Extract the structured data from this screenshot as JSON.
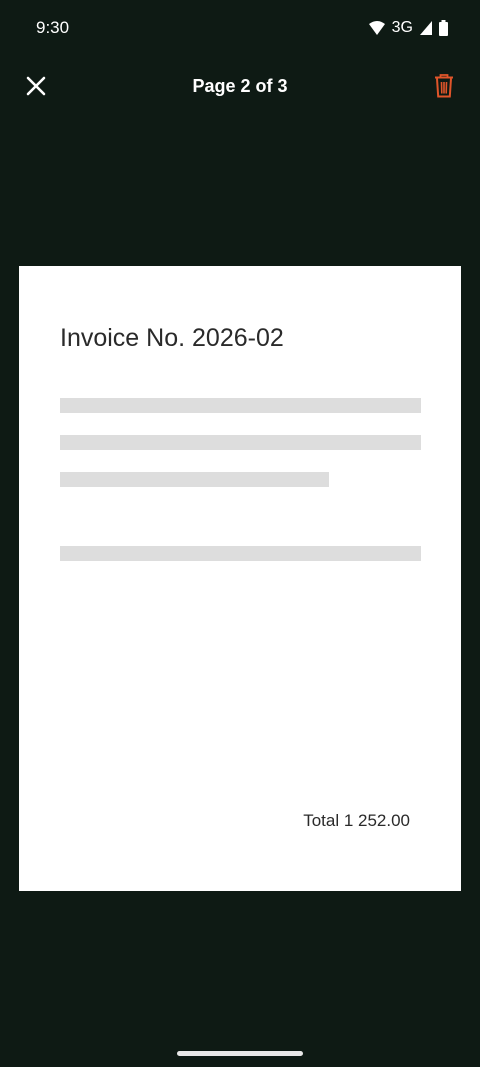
{
  "status_bar": {
    "time": "9:30",
    "network": "3G",
    "icons": [
      "wifi-icon",
      "signal-icon",
      "battery-icon"
    ]
  },
  "toolbar": {
    "title": "Page 2 of 3",
    "close_icon": "close-icon",
    "delete_icon": "trash-icon",
    "delete_color": "#e0552a"
  },
  "document": {
    "heading": "Invoice No. 2026-02",
    "total": "Total 1 252.00"
  },
  "colors": {
    "background": "#0e1a14",
    "page": "#ffffff",
    "placeholder_line": "#dddddd"
  }
}
